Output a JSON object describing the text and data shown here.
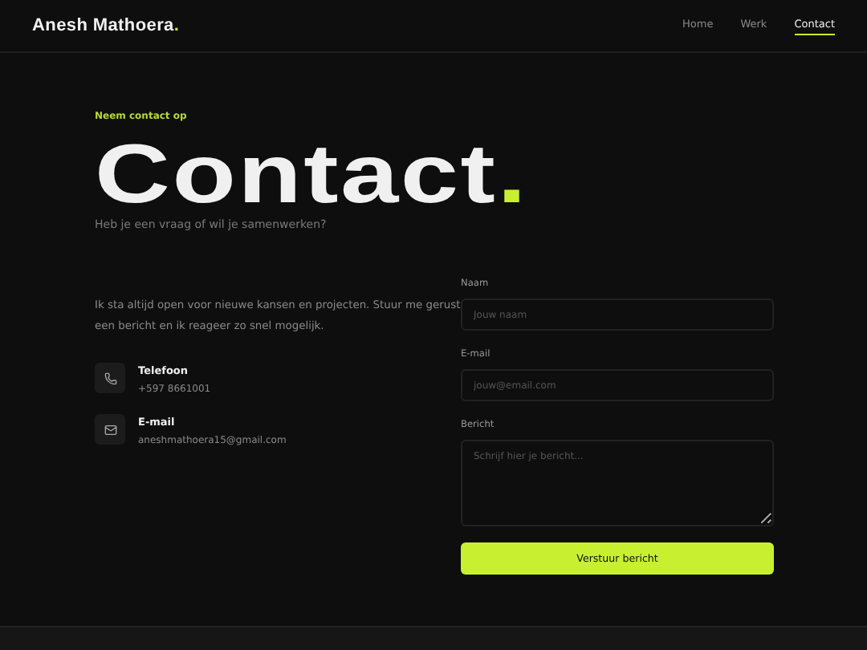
{
  "header": {
    "logo": "Anesh Mathoera",
    "logo_dot": ".",
    "nav": [
      {
        "label": "Home",
        "selected": false
      },
      {
        "label": "Werk",
        "selected": false
      },
      {
        "label": "Contact",
        "selected": true
      }
    ]
  },
  "hero": {
    "eyebrow": "Neem contact op",
    "title": "Contact",
    "title_dot": ".",
    "subtitle": "Heb je een vraag of wil je samenwerken?"
  },
  "intro": "Ik sta altijd open voor nieuwe kansen en projecten. Stuur me gerust een bericht en ik reageer zo snel mogelijk.",
  "contacts": [
    {
      "kind": "phone",
      "label": "Telefoon",
      "value": "+597 8661001"
    },
    {
      "kind": "mail",
      "label": "E-mail",
      "value": "aneshmathoera15@gmail.com"
    }
  ],
  "form": {
    "fields": [
      {
        "kind": "input",
        "label": "Naam",
        "placeholder": "Jouw naam"
      },
      {
        "kind": "input",
        "label": "E-mail",
        "placeholder": "jouw@email.com"
      },
      {
        "kind": "textarea",
        "label": "Bericht",
        "placeholder": "Schrijf hier je bericht..."
      }
    ],
    "submit": "Verstuur bericht"
  }
}
